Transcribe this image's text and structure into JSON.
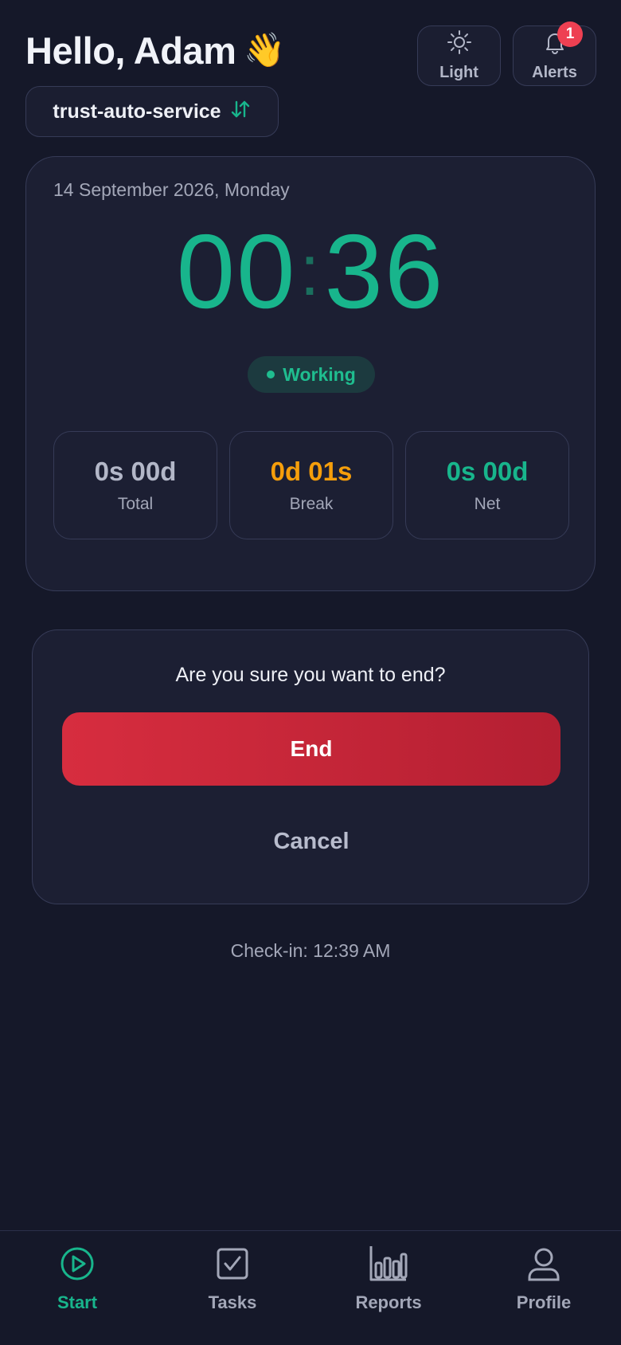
{
  "header": {
    "greeting": "Hello, Adam",
    "wave_emoji": "👋",
    "theme_button_label": "Light",
    "alerts_button_label": "Alerts",
    "alerts_count": "1",
    "workspace_name": "trust-auto-service"
  },
  "timer": {
    "date": "14 September 2026, Monday",
    "hours_part": "00",
    "minutes_part": "36",
    "status": "Working",
    "stats": [
      {
        "value": "0s 00d",
        "caption": "Total",
        "color": "#b3b7c8"
      },
      {
        "value": "0d 01s",
        "caption": "Break",
        "color": "#f59e0b"
      },
      {
        "value": "0s 00d",
        "caption": "Net",
        "color": "#18b58c"
      }
    ]
  },
  "confirm": {
    "question": "Are you sure you want to end?",
    "end_label": "End",
    "cancel_label": "Cancel"
  },
  "checkin_text": "Check-in: 12:39 AM",
  "nav": {
    "items": [
      {
        "label": "Start",
        "icon": "play-circle-icon",
        "active": true
      },
      {
        "label": "Tasks",
        "icon": "checkbox-icon",
        "active": false
      },
      {
        "label": "Reports",
        "icon": "bar-chart-icon",
        "active": false
      },
      {
        "label": "Profile",
        "icon": "user-icon",
        "active": false
      }
    ]
  },
  "colors": {
    "accent": "#18b58c",
    "danger": "#d72d3f",
    "warning": "#f59e0b",
    "background": "#151829"
  }
}
